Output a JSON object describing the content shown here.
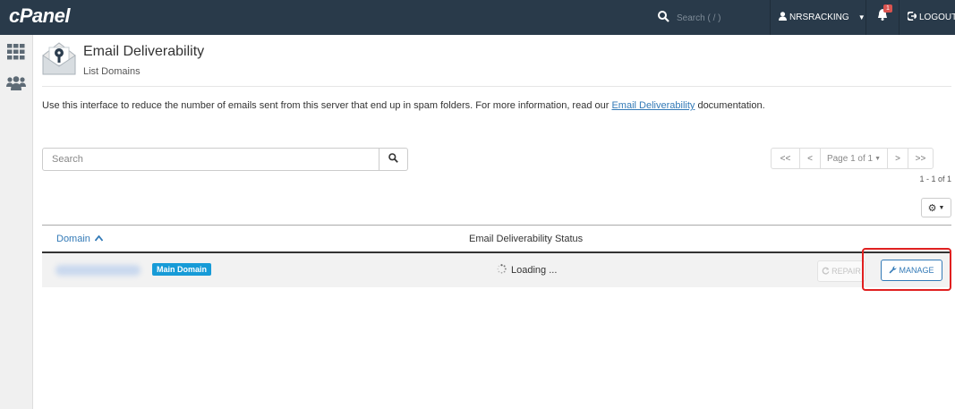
{
  "topbar": {
    "logo": "cPanel",
    "search_placeholder": "Search ( / )",
    "user": "NRSRACKING",
    "notification_count": "1",
    "logout": "LOGOUT"
  },
  "sidebar": {
    "items": [
      {
        "icon": "grid-icon"
      },
      {
        "icon": "users-icon"
      }
    ]
  },
  "header": {
    "title": "Email Deliverability",
    "subtitle": "List Domains"
  },
  "description": {
    "before": "Use this interface to reduce the number of emails sent from this server that end up in spam folders. For more information, read our ",
    "link": "Email Deliverability",
    "after": " documentation."
  },
  "search": {
    "placeholder": "Search"
  },
  "pagination": {
    "first": "<<",
    "prev": "<",
    "page": "Page 1 of 1",
    "next": ">",
    "last": ">>",
    "range": "1 - 1 of 1"
  },
  "table": {
    "columns": {
      "domain": "Domain",
      "status": "Email Deliverability Status"
    },
    "rows": [
      {
        "domain_badge": "Main Domain",
        "status": "Loading ...",
        "repair": "REPAIR",
        "manage": "MANAGE"
      }
    ]
  },
  "colors": {
    "topbar": "#293a4a",
    "link": "#337ab7",
    "badge": "#179bd7",
    "highlight": "#e02020"
  }
}
